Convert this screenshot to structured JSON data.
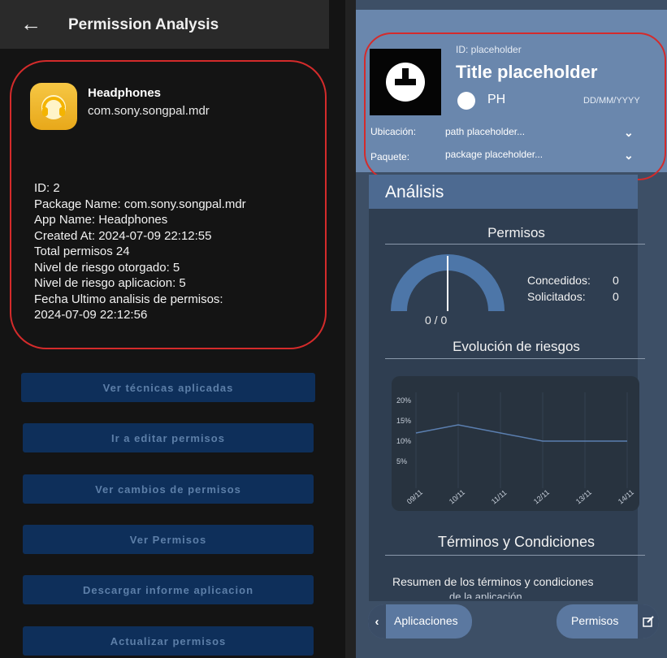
{
  "left": {
    "header": {
      "back_icon": "arrow-left-icon",
      "title": "Permission Analysis"
    },
    "app": {
      "icon": "headphones-icon",
      "name": "Headphones",
      "package": "com.sony.songpal.mdr"
    },
    "details": [
      "ID: 2",
      "Package Name: com.sony.songpal.mdr",
      "App Name: Headphones",
      "Created At: 2024-07-09 22:12:55",
      "Total permisos 24",
      "Nivel de riesgo otorgado: 5",
      "Nivel de riesgo aplicacion: 5",
      "Fecha Ultimo analisis de permisos:",
      "2024-07-09 22:12:56"
    ],
    "buttons": [
      "Ver técnicas aplicadas",
      "Ir a editar permisos",
      "Ver cambios de permisos",
      "Ver Permisos",
      "Descargar informe aplicacion",
      "Actualizar permisos"
    ]
  },
  "right": {
    "header": {
      "logo_icon": "uber-logo-icon",
      "id_label": "ID: placeholder",
      "title": "Title placeholder",
      "ph": "PH",
      "date": "DD/MM/YYYY",
      "ubicacion_label": "Ubicación:",
      "ubicacion_value": "path placeholder...",
      "paquete_label": "Paquete:",
      "paquete_value": "package placeholder..."
    },
    "analysis": {
      "title": "Análisis",
      "permisos_title": "Permisos",
      "gauge_value": "0 / 0",
      "concedidos_label": "Concedidos:",
      "concedidos_value": "0",
      "solicitados_label": "Solicitados:",
      "solicitados_value": "0",
      "evolucion_title": "Evolución de riesgos",
      "terminos_title": "Términos y Condiciones",
      "terminos_text": "Resumen de los términos y condiciones",
      "terminos_text2": "de la aplicación"
    },
    "nav": {
      "back_label": "Aplicaciones",
      "permisos_label": "Permisos",
      "chevron_icon": "chevron-left-icon",
      "edit_icon": "edit-icon"
    }
  },
  "chart_data": {
    "type": "line",
    "x": [
      "09/11",
      "10/11",
      "11/11",
      "12/11",
      "13/11",
      "14/11"
    ],
    "series": [
      {
        "values": [
          12,
          14,
          12,
          10,
          10,
          10
        ]
      }
    ],
    "yticks": [
      "20%",
      "15%",
      "10%",
      "5%"
    ],
    "ylim": [
      0,
      20
    ],
    "grid": true,
    "color": "#5b7fb0"
  }
}
